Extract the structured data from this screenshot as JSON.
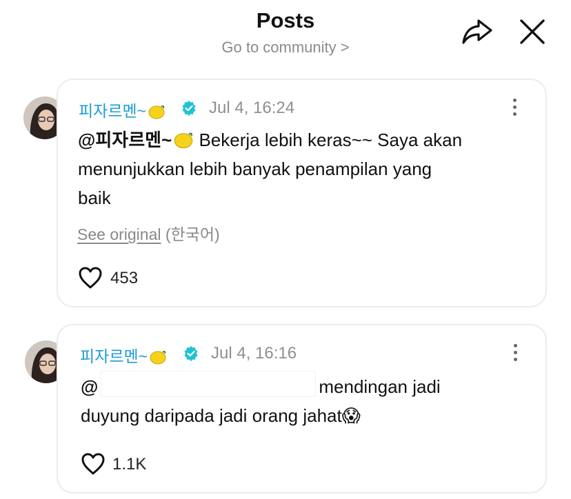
{
  "header": {
    "title": "Posts",
    "subtitle": "Go to community >",
    "share_icon": "share-arrow-icon",
    "close_icon": "close-x-icon"
  },
  "posts": [
    {
      "author": "피자르멘~",
      "emoji": "lemon",
      "verified": true,
      "date": "Jul 4, 16:24",
      "mention": "@피자르멘~",
      "text_line1": "Bekerja lebih keras~~ Saya akan",
      "text_line2": "menunjukkan lebih banyak penampilan yang",
      "text_line3": "baik",
      "see_original": "See original",
      "language": "(한국어)",
      "likes": "453"
    },
    {
      "author": "피자르멘~",
      "emoji": "lemon",
      "verified": true,
      "date": "Jul 4, 16:16",
      "mention": "@",
      "text_line1": "mendingan jadi",
      "text_line2": "duyung daripada jadi orang jahat",
      "text_emoji": "😱",
      "likes": "1.1K"
    }
  ],
  "colors": {
    "accent": "#1d9bd7",
    "verified": "#20c3d6",
    "muted": "#8f8f8f"
  }
}
